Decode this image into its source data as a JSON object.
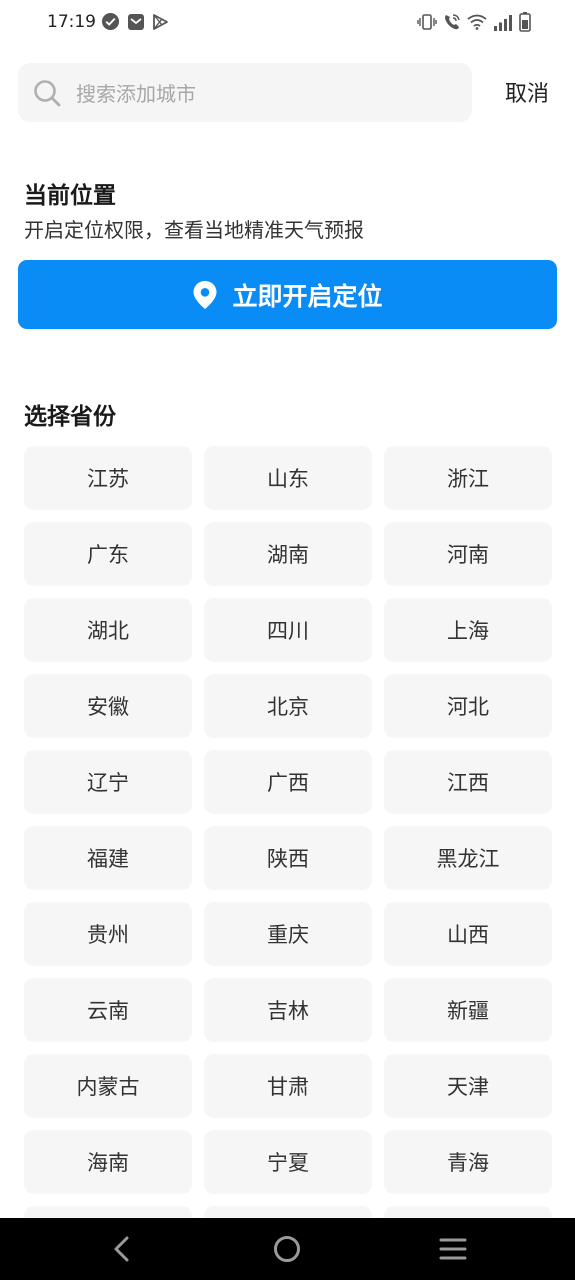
{
  "status_bar": {
    "time": "17:19",
    "left_icons": [
      "check-circle-icon",
      "mail-icon",
      "play-store-icon"
    ],
    "right_icons": [
      "vibrate-icon",
      "wifi-call-icon",
      "wifi-icon",
      "signal-icon",
      "battery-icon"
    ]
  },
  "search": {
    "placeholder": "搜索添加城市",
    "value": "",
    "cancel_label": "取消"
  },
  "location": {
    "title": "当前位置",
    "subtitle": "开启定位权限，查看当地精准天气预报",
    "button_label": "立即开启定位",
    "button_icon": "location-pin-icon"
  },
  "provinces": {
    "title": "选择省份",
    "items": [
      "江苏",
      "山东",
      "浙江",
      "广东",
      "湖南",
      "河南",
      "湖北",
      "四川",
      "上海",
      "安徽",
      "北京",
      "河北",
      "辽宁",
      "广西",
      "江西",
      "福建",
      "陕西",
      "黑龙江",
      "贵州",
      "重庆",
      "山西",
      "云南",
      "吉林",
      "新疆",
      "内蒙古",
      "甘肃",
      "天津",
      "海南",
      "宁夏",
      "青海"
    ]
  },
  "nav_bar": {
    "icons": [
      "back-icon",
      "home-icon",
      "menu-icon"
    ]
  },
  "colors": {
    "accent": "#0a8cf7",
    "cell_bg": "#f6f6f6",
    "search_bg": "#f5f5f5"
  }
}
